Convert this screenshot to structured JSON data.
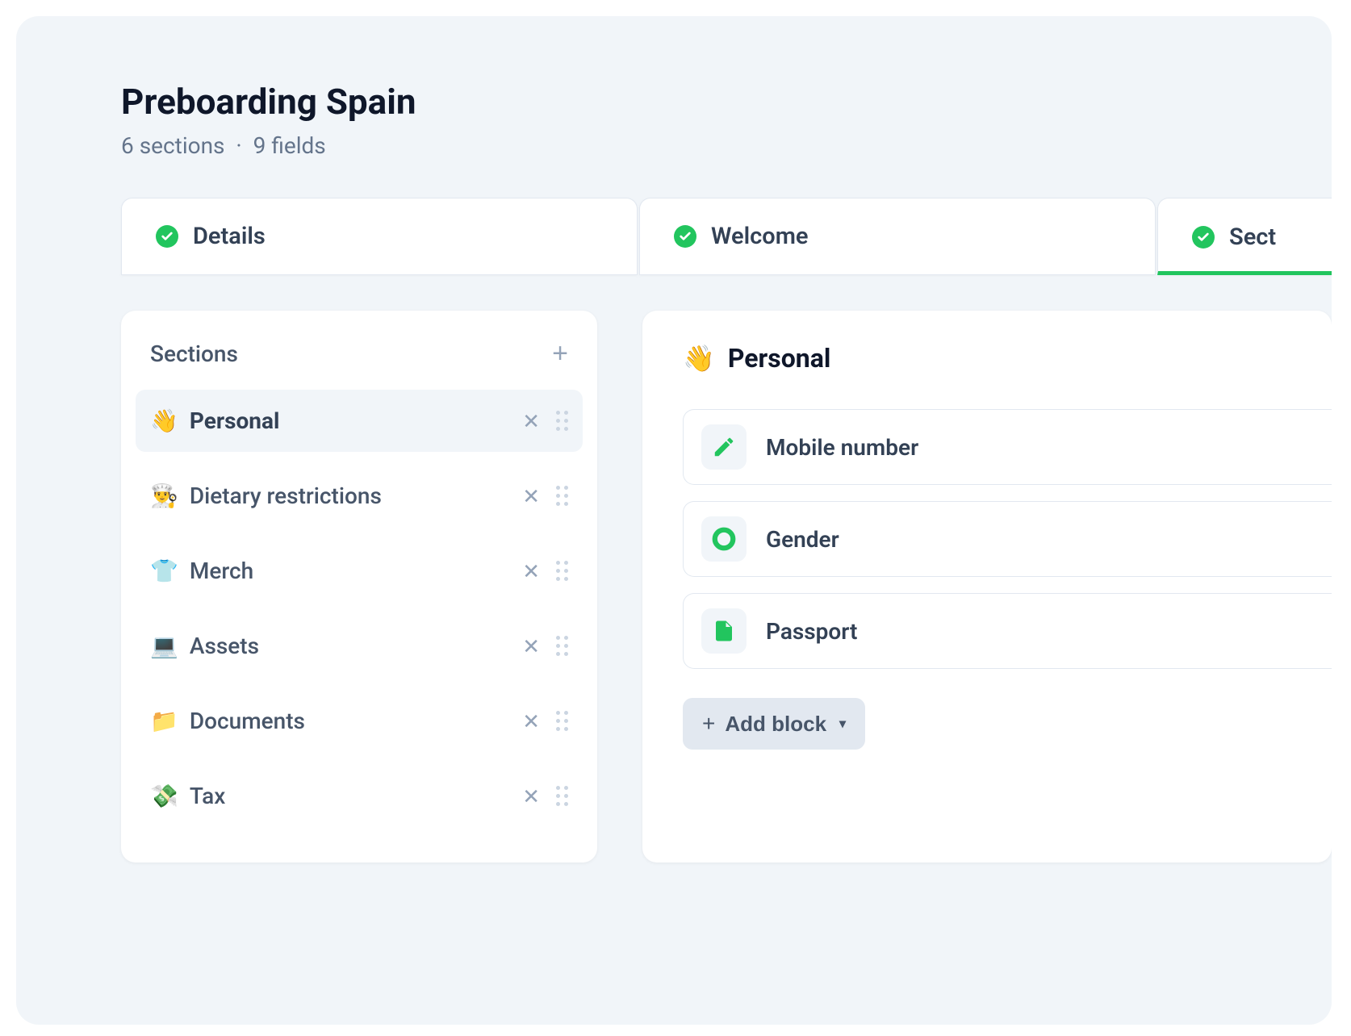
{
  "header": {
    "title": "Preboarding Spain",
    "sections_count": 6,
    "sections_word": "sections",
    "separator": "·",
    "fields_count": 9,
    "fields_word": "fields"
  },
  "tabs": [
    {
      "label": "Details",
      "complete": true,
      "active": false
    },
    {
      "label": "Welcome",
      "complete": true,
      "active": false
    },
    {
      "label": "Sect",
      "complete": true,
      "active": true
    }
  ],
  "sections": {
    "title": "Sections",
    "items": [
      {
        "emoji": "👋",
        "name": "Personal",
        "selected": true
      },
      {
        "emoji": "👨‍🍳",
        "name": "Dietary restrictions",
        "selected": false
      },
      {
        "emoji": "👕",
        "name": "Merch",
        "selected": false
      },
      {
        "emoji": "💻",
        "name": "Assets",
        "selected": false
      },
      {
        "emoji": "📁",
        "name": "Documents",
        "selected": false
      },
      {
        "emoji": "💸",
        "name": "Tax",
        "selected": false
      }
    ]
  },
  "current_section": {
    "emoji": "👋",
    "name": "Personal",
    "fields": [
      {
        "icon": "edit",
        "name": "Mobile number"
      },
      {
        "icon": "radio",
        "name": "Gender"
      },
      {
        "icon": "document",
        "name": "Passport"
      }
    ],
    "add_block_label": "Add block"
  },
  "colors": {
    "accent": "#22c55e",
    "text_primary": "#0f172a",
    "text_secondary": "#475569",
    "text_muted": "#64748b",
    "surface": "#ffffff",
    "surface_muted": "#f1f5f9",
    "border": "#e2e8f0"
  }
}
